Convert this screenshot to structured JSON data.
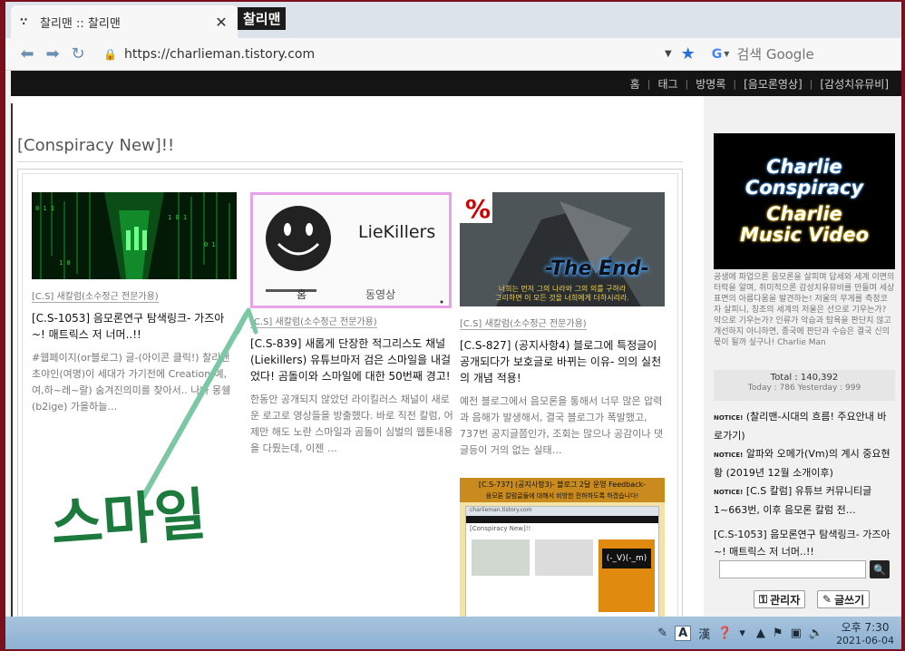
{
  "browser": {
    "tab_title": "찰리맨 :: 찰리맨",
    "tab_favicon": "∵",
    "tab_close": "✕",
    "tooltip": "찰리맨",
    "url": "https://charlieman.tistory.com",
    "search_placeholder": "검색 Google",
    "search_engine_letter": "G"
  },
  "blog": {
    "top_nav": [
      "홈",
      "태그",
      "방명록",
      "[음모론영상]",
      "[감성치유뮤비]"
    ],
    "section_title": "[Conspiracy New]!!",
    "cards": [
      {
        "category": "[C.S] 새칼럼(소수정근 전문가용)",
        "title": "[C.S-1053] 음모론연구 탐색링크- 가즈아~! 매트릭스 저 너머..!!",
        "description": "#웹페이지(or블로그) 글-(아이콘 클릭!) 찰리맨 초야인(여명)이 세대가 가기전에 Creation(예,여,하~레~랄) 숨겨진의미를 찾아서.. 나나 몽쉘(b2ige) 가을하늘…"
      },
      {
        "category": "[C.S] 새칼럼(소수정근 전문가용)",
        "title": "[C.S-839] 새롭게 단장한 적그리스도 채널(Liekillers) 유튜브마저 검은 스마일을 내걸었다! 곰돌이와 스마일에 대한 50번째 경고!",
        "description": "한동안 공개되지 않았던 라이킬러스 채널이 새로운 로고로 영상들을 방출했다. 바로 직전 칼럼, 어제만 해도 노란 스마일과 곰돌이 심벌의 웹툰내용을 다뤘는데, 이젠 …",
        "thumb_channel": "LieKillers",
        "thumb_tab_home": "홈",
        "thumb_tab_video": "동영상"
      },
      {
        "category": "[C.S] 새칼럼(소수정근 전문가용)",
        "title": "[C.S-827] (공지사항4) 블로그에 특정글이 공개되다가 보호글로 바뀌는 이유- 의의 실천의 개념 적용!",
        "description": "예전 블로그에서 음모론을 통해서 너무 많은 압력과 음해가 발생해서, 결국 블로그가 폭발했고, 737번 공지글쯤인가, 조회는 많으나 공감이나 댓글등이 거의 없는 실태…",
        "thumb_text": "-The End-",
        "thumb_caption": "너희는 먼저 그의 나라와 그의 의를 구하라\n그리하면 이 모든 것을 너희에게 더하시리라.",
        "thumb_badge": "%"
      }
    ],
    "fourth_card": {
      "header": "[C.S-737] (공지사항3)- 블로그 2달 운영 Feedback-",
      "subheader": "음모론 칼럼글들에 대해서 비방한 전하하도록 하겠습니다!",
      "inner_title": "[Conspiracy New]!!",
      "inner_url": "charlieman.tistory.com",
      "emote": "(-_V)(-_m)"
    }
  },
  "sidebar": {
    "banner_lines": [
      "Charlie",
      "Conspiracy",
      "Charlie",
      "Music Video"
    ],
    "description": "공생에 파업으론 음모론을 살피며 답세와 세계 이면의 터락을 알며, 취미적으론 감성치유뮤비를 만들며 세상표면의 아름다움을 발견하는! 저울의 무게를 측정코자 살피니, 칭조의 세계의 저울은 선으로 기우는가? 악으로 기우는가? 인류가 악습과 탐욕을 판단치 않고 개선하지 아니하면, 종국에 판단과 수습은 결국 신의 몫이 될까 싶구나! Charlie Man",
    "total": "Total : 140,392",
    "today_yesterday": "Today : 786    Yesterday : 999",
    "notice_tag": "NOTICE!",
    "notices": [
      "(찰리맨-시대의 흐름! 주요안내 바로가기)",
      "알파와 오메가(Vm)의 계시 중요현황 (2019년 12월 소개이후)",
      "[C.S 칼럼] 유튜브 커뮤니티글 1~663번, 이후 음모론 칼럼 전…"
    ],
    "recent_post": "[C.S-1053] 음모론연구 탐색링크- 가즈아~! 매트릭스 저 너머..!!",
    "admin_button": "관리자",
    "write_button": "글쓰기"
  },
  "taskbar": {
    "ime_a": "A",
    "ime_han": "漢",
    "time": "오후 7:30",
    "date": "2021-06-04"
  },
  "annotation": {
    "handwritten_text": "스마일",
    "color": "#1c7a3c",
    "arrow_color": "#7cc8a6"
  },
  "colors": {
    "window_frame": "#7a0f1e",
    "tab_strip": "#dde3ea",
    "nav_bar": "#141414",
    "highlight_border": "#e8a3e8",
    "bookmark_star": "#2a6fd6"
  }
}
